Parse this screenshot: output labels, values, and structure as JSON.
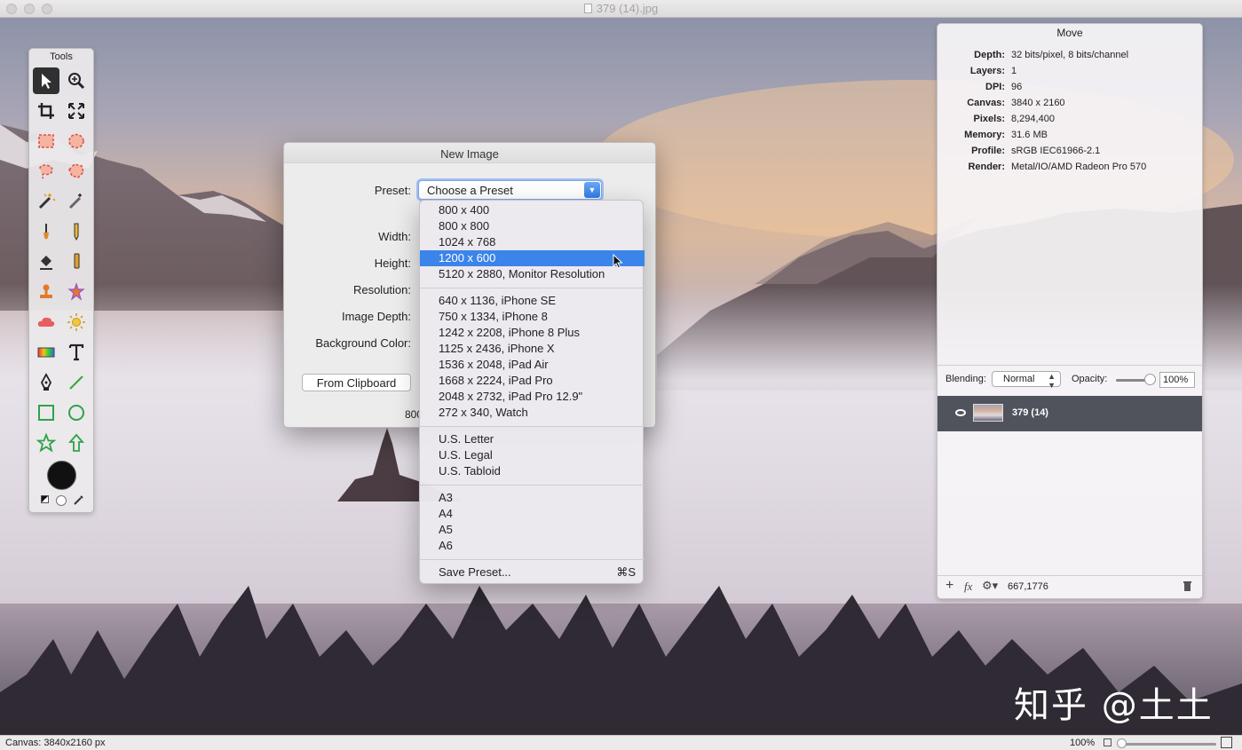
{
  "window": {
    "title": "379 (14).jpg"
  },
  "tools": {
    "title": "Tools",
    "icons": [
      "move-arrow",
      "zoom",
      "crop",
      "fit",
      "rect-select",
      "ellipse-select",
      "lasso",
      "polygon-lasso",
      "magic-wand",
      "magic-brush",
      "paint-brush",
      "pencil",
      "paint-bucket",
      "smudge",
      "clone-stamp",
      "spray",
      "cloud",
      "sun-burn",
      "gradient",
      "text",
      "pen",
      "line",
      "rectangle",
      "ellipse",
      "star",
      "arrow"
    ]
  },
  "dialog": {
    "title": "New Image",
    "labels": {
      "preset": "Preset:",
      "width": "Width:",
      "height": "Height:",
      "resolution": "Resolution:",
      "image_depth": "Image Depth:",
      "background_color": "Background Color:"
    },
    "preset_value": "Choose a Preset",
    "from_clipboard": "From Clipboard",
    "partial_text": "800"
  },
  "menu": {
    "groups": [
      [
        "800 x 400",
        "800 x 800",
        "1024 x 768",
        "1200 x 600",
        "5120 x 2880, Monitor Resolution"
      ],
      [
        "640 x 1136, iPhone SE",
        "750 x 1334, iPhone 8",
        "1242 x 2208, iPhone 8 Plus",
        "1125 x 2436, iPhone X",
        "1536 x 2048, iPad Air",
        "1668 x 2224, iPad Pro",
        "2048 x 2732, iPad Pro 12.9\"",
        "272 x 340,  Watch"
      ],
      [
        "U.S. Letter",
        "U.S. Legal",
        "U.S. Tabloid"
      ],
      [
        "A3",
        "A4",
        "A5",
        "A6"
      ]
    ],
    "selected": "1200 x 600",
    "save_preset": "Save Preset...",
    "save_shortcut": "⌘S"
  },
  "panel": {
    "title": "Move",
    "info": [
      {
        "key": "Depth:",
        "value": "32 bits/pixel, 8 bits/channel"
      },
      {
        "key": "Layers:",
        "value": "1"
      },
      {
        "key": "DPI:",
        "value": "96"
      },
      {
        "key": "Canvas:",
        "value": "3840 x 2160"
      },
      {
        "key": "Pixels:",
        "value": "8,294,400"
      },
      {
        "key": "Memory:",
        "value": "31.6 MB"
      },
      {
        "key": "Profile:",
        "value": "sRGB IEC61966-2.1"
      },
      {
        "key": "Render:",
        "value": "Metal/IO/AMD Radeon Pro 570"
      }
    ],
    "blending_label": "Blending:",
    "blending_value": "Normal",
    "opacity_label": "Opacity:",
    "opacity_value": "100%",
    "opacity_level": 1.0,
    "layer_name": "379 (14)",
    "footer_coords": "667,1776"
  },
  "status": {
    "canvas": "Canvas: 3840x2160 px",
    "zoom": "100%"
  },
  "watermark": "知乎 @土土"
}
